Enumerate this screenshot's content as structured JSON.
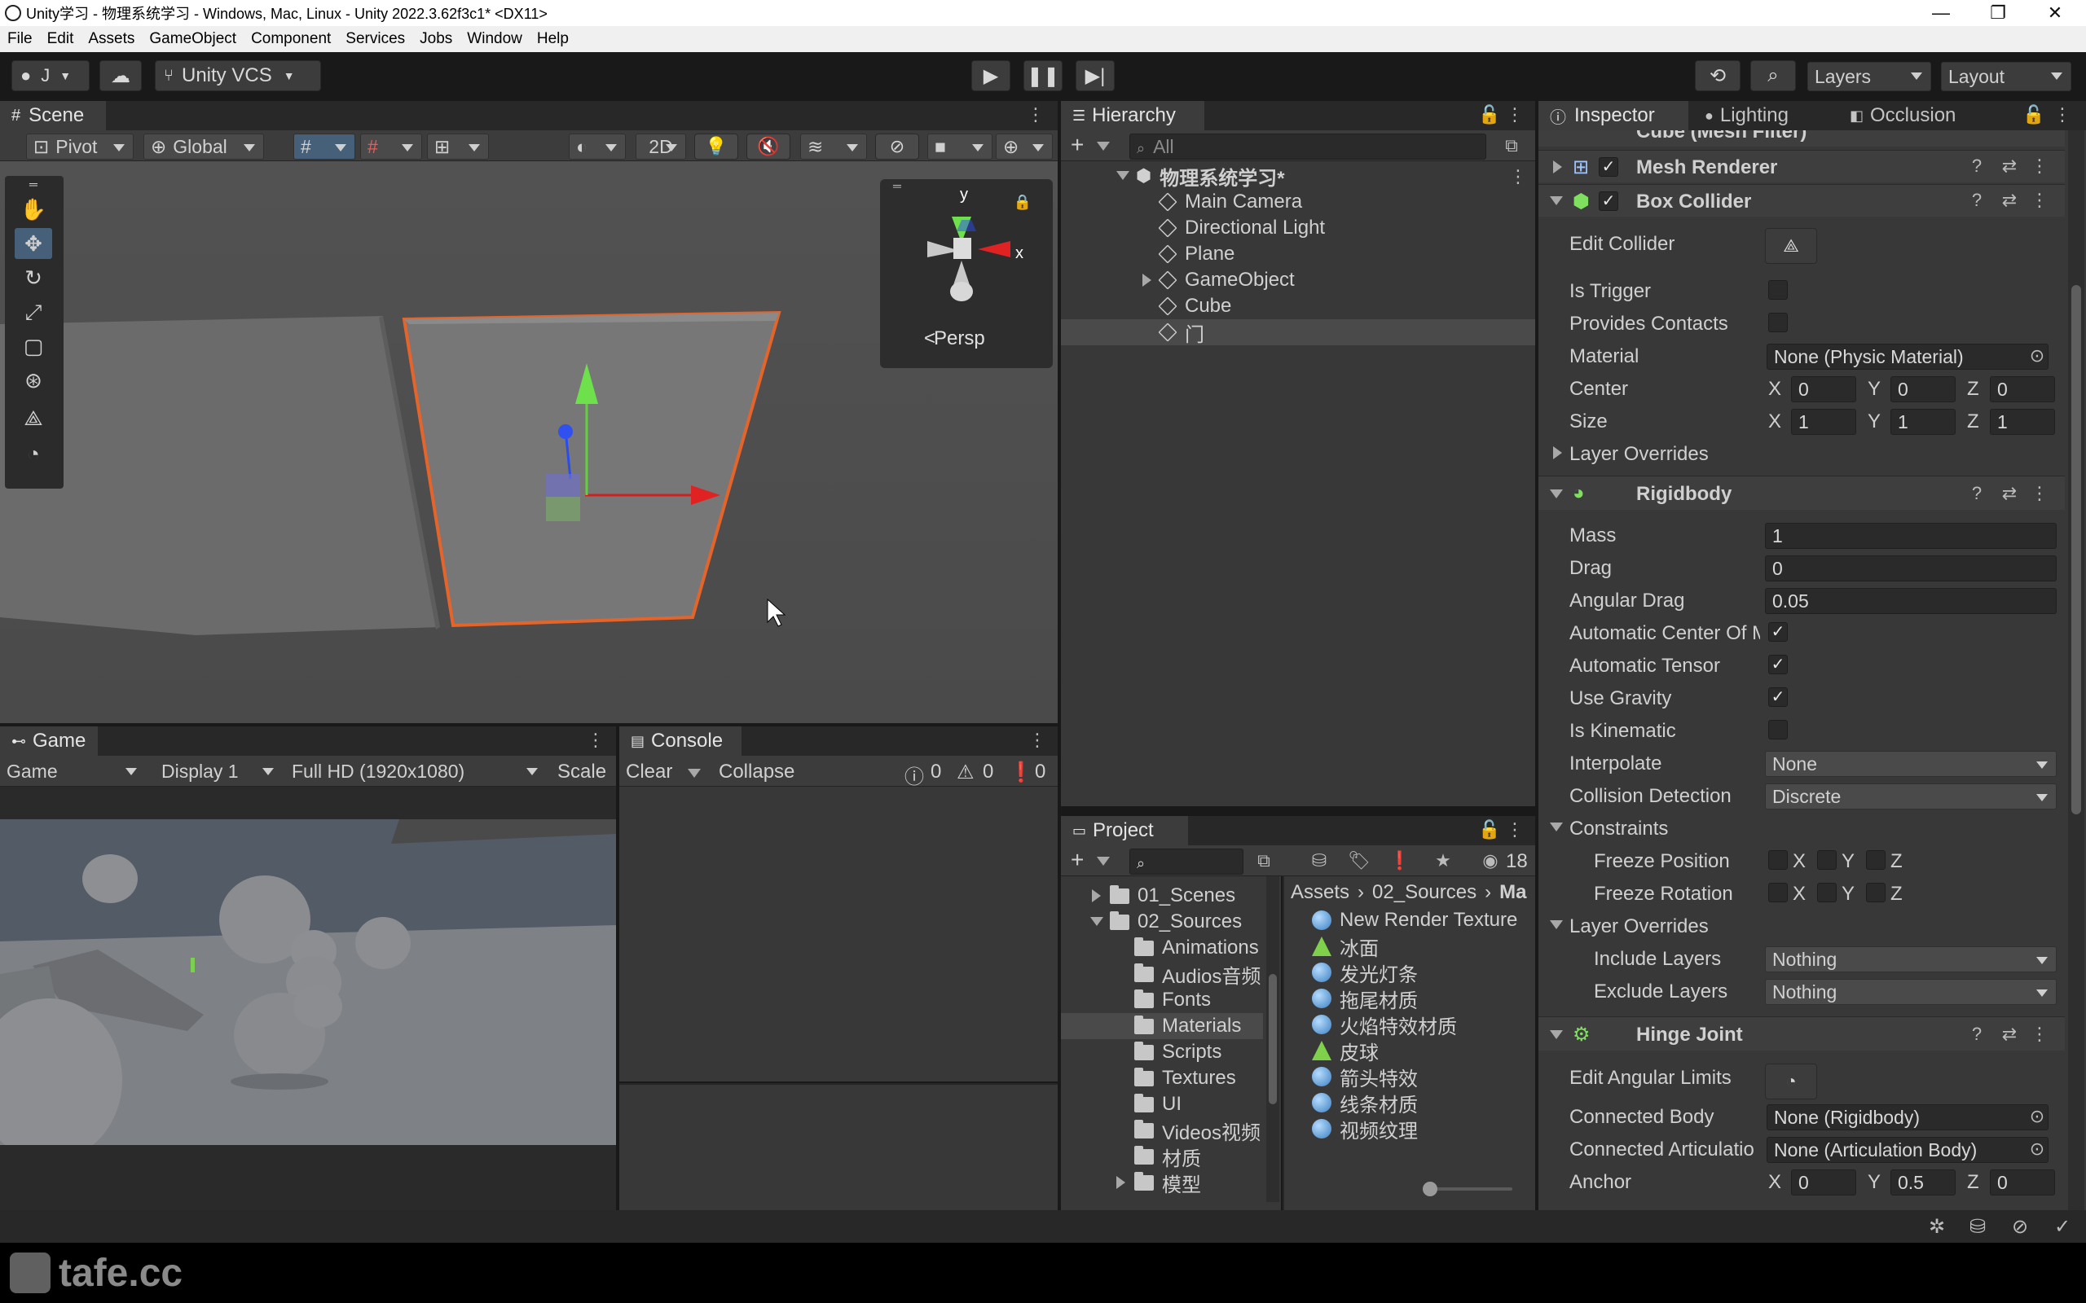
{
  "window": {
    "title": "Unity学习 - 物理系统学习 - Windows, Mac, Linux - Unity 2022.3.62f3c1* <DX11>",
    "minimize": "—",
    "maximize": "❐",
    "close": "✕"
  },
  "menu": [
    "File",
    "Edit",
    "Assets",
    "GameObject",
    "Component",
    "Services",
    "Jobs",
    "Window",
    "Help"
  ],
  "toolbar": {
    "account": "J",
    "vcs": "Unity VCS",
    "layers": "Layers",
    "layout": "Layout"
  },
  "scene": {
    "tab": "Scene",
    "pivot": "Pivot",
    "global": "Global",
    "mode2d": "2D",
    "gizmo_view": "Persp",
    "axis_y": "y",
    "axis_x": "x"
  },
  "game": {
    "tab": "Game",
    "mode": "Game",
    "display": "Display 1",
    "resolution": "Full HD (1920x1080)",
    "scale": "Scale"
  },
  "console": {
    "tab": "Console",
    "clear": "Clear",
    "collapse": "Collapse",
    "errors": "0",
    "warnings": "0",
    "messages": "0"
  },
  "hierarchy": {
    "tab": "Hierarchy",
    "search_placeholder": "All",
    "scene_name": "物理系统学习*",
    "items": [
      "Main Camera",
      "Directional Light",
      "Plane",
      "GameObject",
      "Cube",
      "门"
    ]
  },
  "project": {
    "tab": "Project",
    "hidden_count": "18",
    "tree": [
      "01_Scenes",
      "02_Sources",
      "Animations",
      "Audios音频",
      "Fonts",
      "Materials",
      "Scripts",
      "Textures",
      "UI",
      "Videos视频",
      "材质",
      "模型"
    ],
    "breadcrumb": [
      "Assets",
      "02_Sources",
      "Ma"
    ],
    "assets": [
      "New Render Texture",
      "冰面",
      "发光灯条",
      "拖尾材质",
      "火焰特效材质",
      "皮球",
      "箭头特效",
      "线条材质",
      "视频纹理"
    ]
  },
  "inspector": {
    "tabs": [
      "Inspector",
      "Lighting",
      "Occlusion"
    ],
    "cut_component": "Cube (Mesh Filter)",
    "mesh_renderer": "Mesh Renderer",
    "box_collider": {
      "title": "Box Collider",
      "edit_collider": "Edit Collider",
      "is_trigger": "Is Trigger",
      "provides_contacts": "Provides Contacts",
      "material_label": "Material",
      "material_value": "None (Physic Material)",
      "center_label": "Center",
      "center": {
        "x": "0",
        "y": "0",
        "z": "0"
      },
      "size_label": "Size",
      "size": {
        "x": "1",
        "y": "1",
        "z": "1"
      },
      "layer_overrides": "Layer Overrides"
    },
    "rigidbody": {
      "title": "Rigidbody",
      "mass_label": "Mass",
      "mass": "1",
      "drag_label": "Drag",
      "drag": "0",
      "angular_drag_label": "Angular Drag",
      "angular_drag": "0.05",
      "auto_center": "Automatic Center Of M",
      "auto_tensor": "Automatic Tensor",
      "use_gravity": "Use Gravity",
      "is_kinematic": "Is Kinematic",
      "interpolate_label": "Interpolate",
      "interpolate": "None",
      "collision_label": "Collision Detection",
      "collision": "Discrete",
      "constraints": "Constraints",
      "freeze_position": "Freeze Position",
      "freeze_rotation": "Freeze Rotation",
      "layer_overrides": "Layer Overrides",
      "include_label": "Include Layers",
      "include": "Nothing",
      "exclude_label": "Exclude Layers",
      "exclude": "Nothing"
    },
    "hinge": {
      "title": "Hinge Joint",
      "edit_limits": "Edit Angular Limits",
      "connected_body_label": "Connected Body",
      "connected_body": "None (Rigidbody)",
      "connected_art_label": "Connected Articulatio",
      "connected_art": "None (Articulation Body)",
      "anchor_label": "Anchor",
      "anchor": {
        "x": "0",
        "y": "0.5",
        "z": "0"
      }
    },
    "axes": {
      "x": "X",
      "y": "Y",
      "z": "Z"
    }
  },
  "watermark": "tafe.cc"
}
